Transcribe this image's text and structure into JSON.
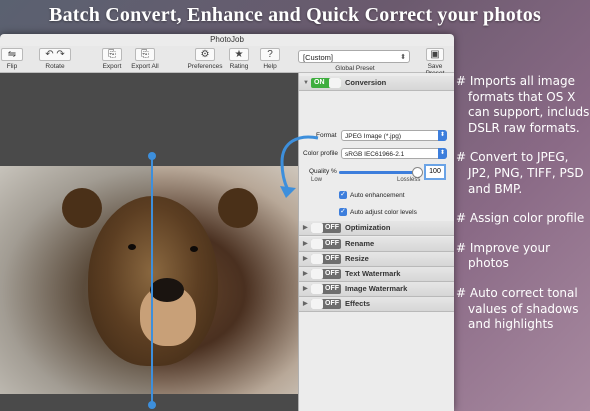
{
  "headline": "Batch Convert, Enhance and Quick Correct your photos",
  "window": {
    "title": "PhotoJob"
  },
  "toolbar": {
    "buttons": [
      {
        "label": "Flip",
        "icon": "flip-icon"
      },
      {
        "label": "Rotate",
        "icon": "rotate-icon"
      },
      {
        "label": "Export",
        "icon": "export-icon"
      },
      {
        "label": "Export All",
        "icon": "export-all-icon"
      },
      {
        "label": "Preferences",
        "icon": "gear-icon"
      },
      {
        "label": "Rating",
        "icon": "star-icon"
      },
      {
        "label": "Help",
        "icon": "help-icon"
      }
    ],
    "preset_value": "[Custom]",
    "preset_label": "Global Preset",
    "save_preset": "Save Preset"
  },
  "panel": {
    "conversion": {
      "toggle": "ON",
      "title": "Conversion",
      "format_label": "Format",
      "format_value": "JPEG Image (*.jpg)",
      "profile_label": "Color profile",
      "profile_value": "sRGB IEC61966-2.1",
      "quality_label": "Quality %",
      "quality_value": "100",
      "quality_fraction": 1.0,
      "low_label": "Low",
      "lossless_label": "Lossless",
      "auto_enhancement": "Auto enhancement",
      "auto_adjust": "Auto adjust color levels"
    },
    "sections": [
      {
        "toggle": "OFF",
        "title": "Optimization"
      },
      {
        "toggle": "OFF",
        "title": "Rename"
      },
      {
        "toggle": "OFF",
        "title": "Resize"
      },
      {
        "toggle": "OFF",
        "title": "Text Watermark"
      },
      {
        "toggle": "OFF",
        "title": "Image Watermark"
      },
      {
        "toggle": "OFF",
        "title": "Effects"
      }
    ]
  },
  "bullets": [
    "# Imports all image formats that OS X can support, includs DSLR raw formats.",
    "# Convert to JPEG, JP2, PNG, TIFF, PSD and BMP.",
    "# Assign color profile",
    "# Improve your photos",
    "# Auto correct tonal values of shadows and highlights"
  ],
  "colors": {
    "accent": "#3d8fdc",
    "on_toggle": "#3fae3f",
    "off_toggle": "#6e6e6e"
  }
}
